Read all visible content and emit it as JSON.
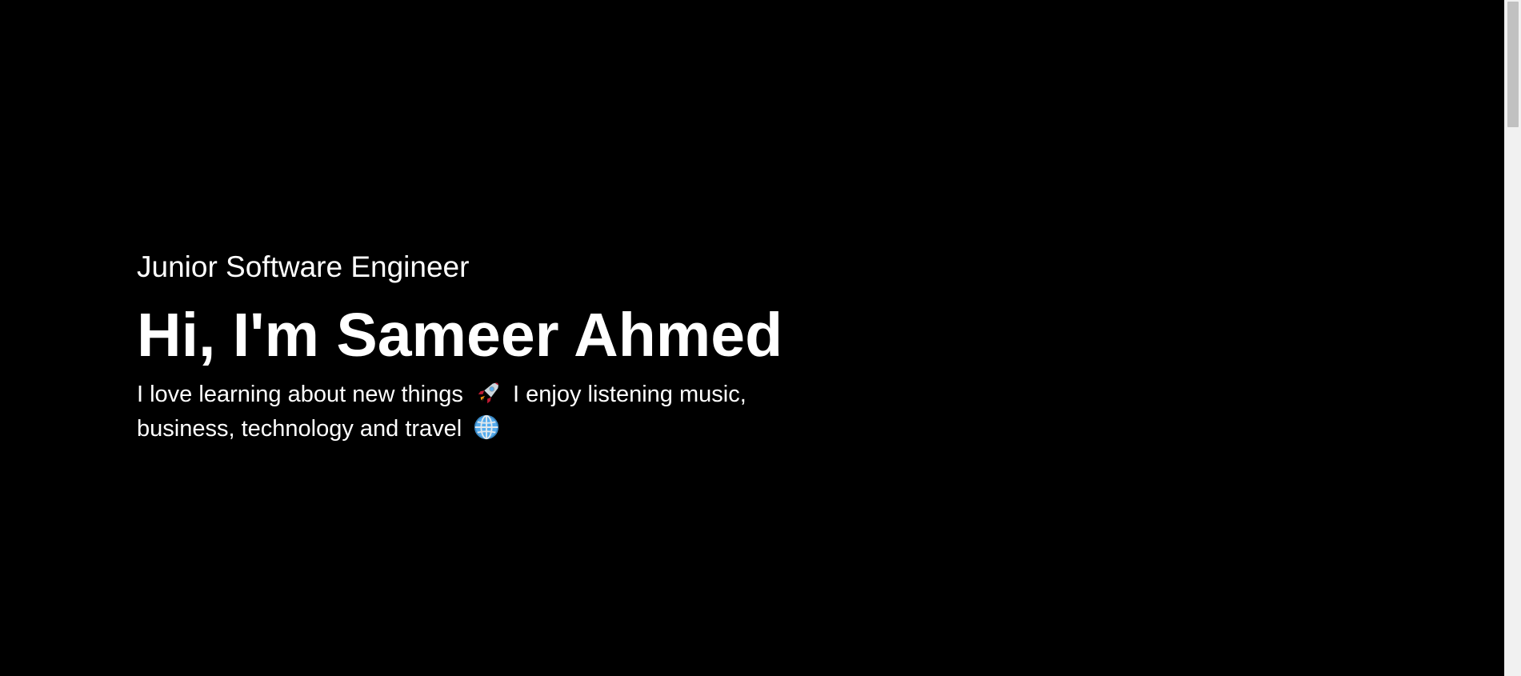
{
  "hero": {
    "subtitle": "Junior Software Engineer",
    "title": "Hi, I'm Sameer Ahmed",
    "bio_part1": "I love learning about new things",
    "bio_emoji1": "rocket-icon",
    "bio_part2": "I enjoy listening music, business, technology and travel",
    "bio_emoji2": "globe-icon"
  },
  "colors": {
    "background": "#000000",
    "text": "#ffffff",
    "scrollbar_track": "#f1f1f1",
    "scrollbar_thumb": "#c1c1c1"
  }
}
